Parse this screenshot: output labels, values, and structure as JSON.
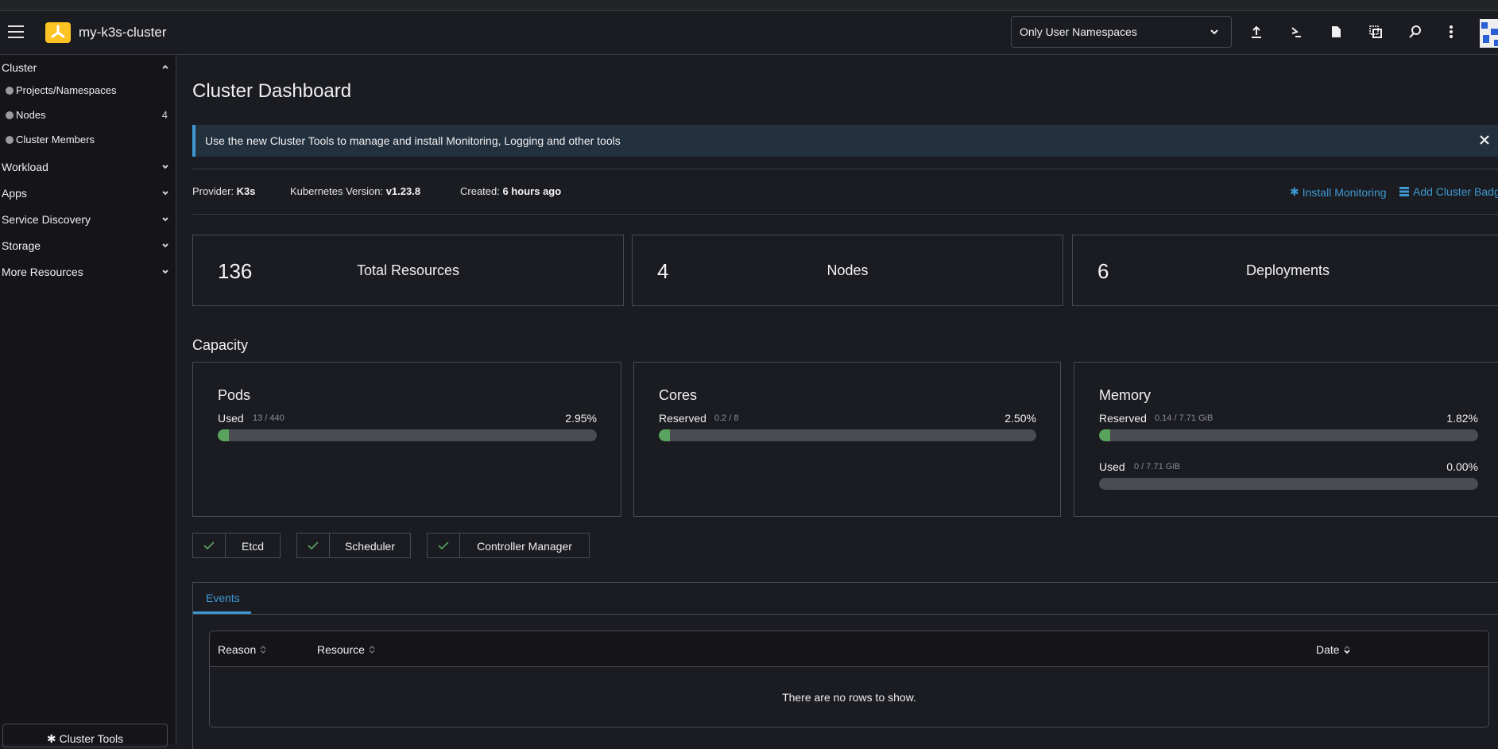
{
  "header": {
    "cluster_name": "my-k3s-cluster",
    "namespace_filter": "Only User Namespaces",
    "toolbar_icons": [
      "import-yaml-icon",
      "kubectl-shell-icon",
      "kubeconfig-file-icon",
      "copy-kubeconfig-icon",
      "search-icon",
      "more-options-icon"
    ]
  },
  "sidebar": {
    "groups": [
      {
        "label": "Cluster",
        "expanded": true
      },
      {
        "label": "Workload",
        "expanded": false
      },
      {
        "label": "Apps",
        "expanded": false
      },
      {
        "label": "Service Discovery",
        "expanded": false
      },
      {
        "label": "Storage",
        "expanded": false
      },
      {
        "label": "More Resources",
        "expanded": false
      }
    ],
    "cluster_items": [
      {
        "label": "Projects/Namespaces",
        "count": ""
      },
      {
        "label": "Nodes",
        "count": "4"
      },
      {
        "label": "Cluster Members",
        "count": ""
      }
    ],
    "cluster_tools_label": "Cluster Tools"
  },
  "main": {
    "title": "Cluster Dashboard",
    "banner": "Use the new Cluster Tools to manage and install Monitoring, Logging and other tools",
    "info": {
      "provider_label": "Provider:",
      "provider_value": "K3s",
      "version_label": "Kubernetes Version:",
      "version_value": "v1.23.8",
      "created_label": "Created:",
      "created_value": "6 hours ago"
    },
    "links": {
      "install_monitoring": "Install Monitoring",
      "add_cluster_badge": "Add Cluster Badge"
    },
    "stats": [
      {
        "value": "136",
        "label": "Total Resources"
      },
      {
        "value": "4",
        "label": "Nodes"
      },
      {
        "value": "6",
        "label": "Deployments"
      }
    ],
    "capacity_title": "Capacity",
    "capacity": [
      {
        "title": "Pods",
        "gauges": [
          {
            "label": "Used",
            "fraction": "13 / 440",
            "percent": "2.95%",
            "value": 2.95
          }
        ]
      },
      {
        "title": "Cores",
        "gauges": [
          {
            "label": "Reserved",
            "fraction": "0.2 / 8",
            "percent": "2.50%",
            "value": 2.5
          }
        ]
      },
      {
        "title": "Memory",
        "gauges": [
          {
            "label": "Reserved",
            "fraction": "0.14 / 7.71 GiB",
            "percent": "1.82%",
            "value": 1.82
          },
          {
            "label": "Used",
            "fraction": "0 / 7.71 GiB",
            "percent": "0.00%",
            "value": 0
          }
        ]
      }
    ],
    "components": [
      {
        "label": "Etcd",
        "status": "healthy"
      },
      {
        "label": "Scheduler",
        "status": "healthy"
      },
      {
        "label": "Controller Manager",
        "status": "healthy"
      }
    ],
    "events": {
      "tab_label": "Events",
      "columns": [
        "Reason",
        "Resource",
        "Date"
      ],
      "empty_text": "There are no rows to show."
    }
  },
  "colors": {
    "accent": "#3d98d3",
    "success": "#5aa35e",
    "logo": "#fdc323",
    "bar_track": "#4b4c52"
  }
}
